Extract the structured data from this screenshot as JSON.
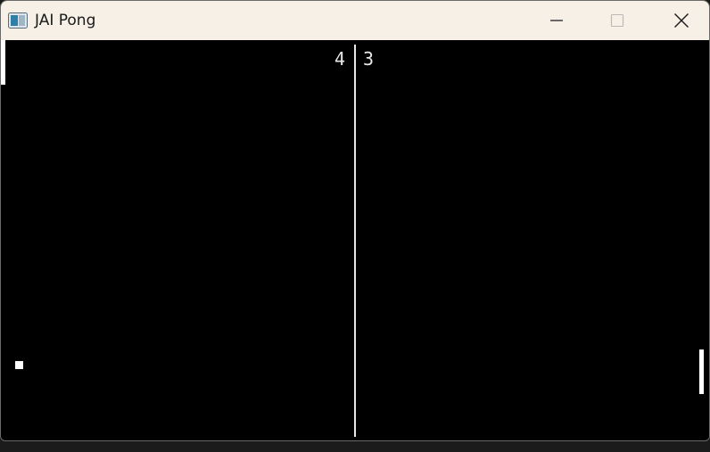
{
  "window": {
    "title": "JAI Pong",
    "icons": {
      "app": "app-window-icon",
      "minimize": "minimize-icon",
      "maximize": "maximize-icon",
      "close": "close-icon"
    }
  },
  "game": {
    "score_left": "4",
    "score_right": "3",
    "colors": {
      "background": "#000000",
      "foreground": "#ffffff",
      "net": "#e8e8e8",
      "titlebar": "#f6f0e7"
    }
  }
}
